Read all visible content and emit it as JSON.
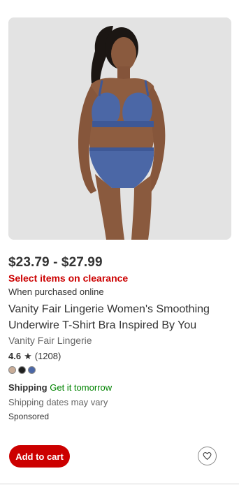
{
  "product": {
    "price": "$23.79 - $27.99",
    "promo": "Select items on clearance",
    "purchase_note": "When purchased online",
    "title": "Vanity Fair Lingerie Women's Smoothing Underwire T-Shirt Bra Inspired By You",
    "brand": "Vanity Fair Lingerie",
    "rating": "4.6",
    "review_count": "(1208)",
    "swatches": [
      "#c9ad98",
      "#1f1f1f",
      "#4b67a6"
    ],
    "shipping_label": "Shipping",
    "shipping_eta": "Get it tomorrow",
    "shipping_note": "Shipping dates may vary",
    "sponsored": "Sponsored"
  },
  "actions": {
    "add_to_cart": "Add to cart"
  },
  "icons": {
    "star": "star-icon",
    "favorite": "heart-icon"
  },
  "colors": {
    "accent_red": "#cc0000",
    "shipping_green": "#008300",
    "image_bg": "#e3e3e3",
    "garment_blue": "#4b67a6"
  }
}
